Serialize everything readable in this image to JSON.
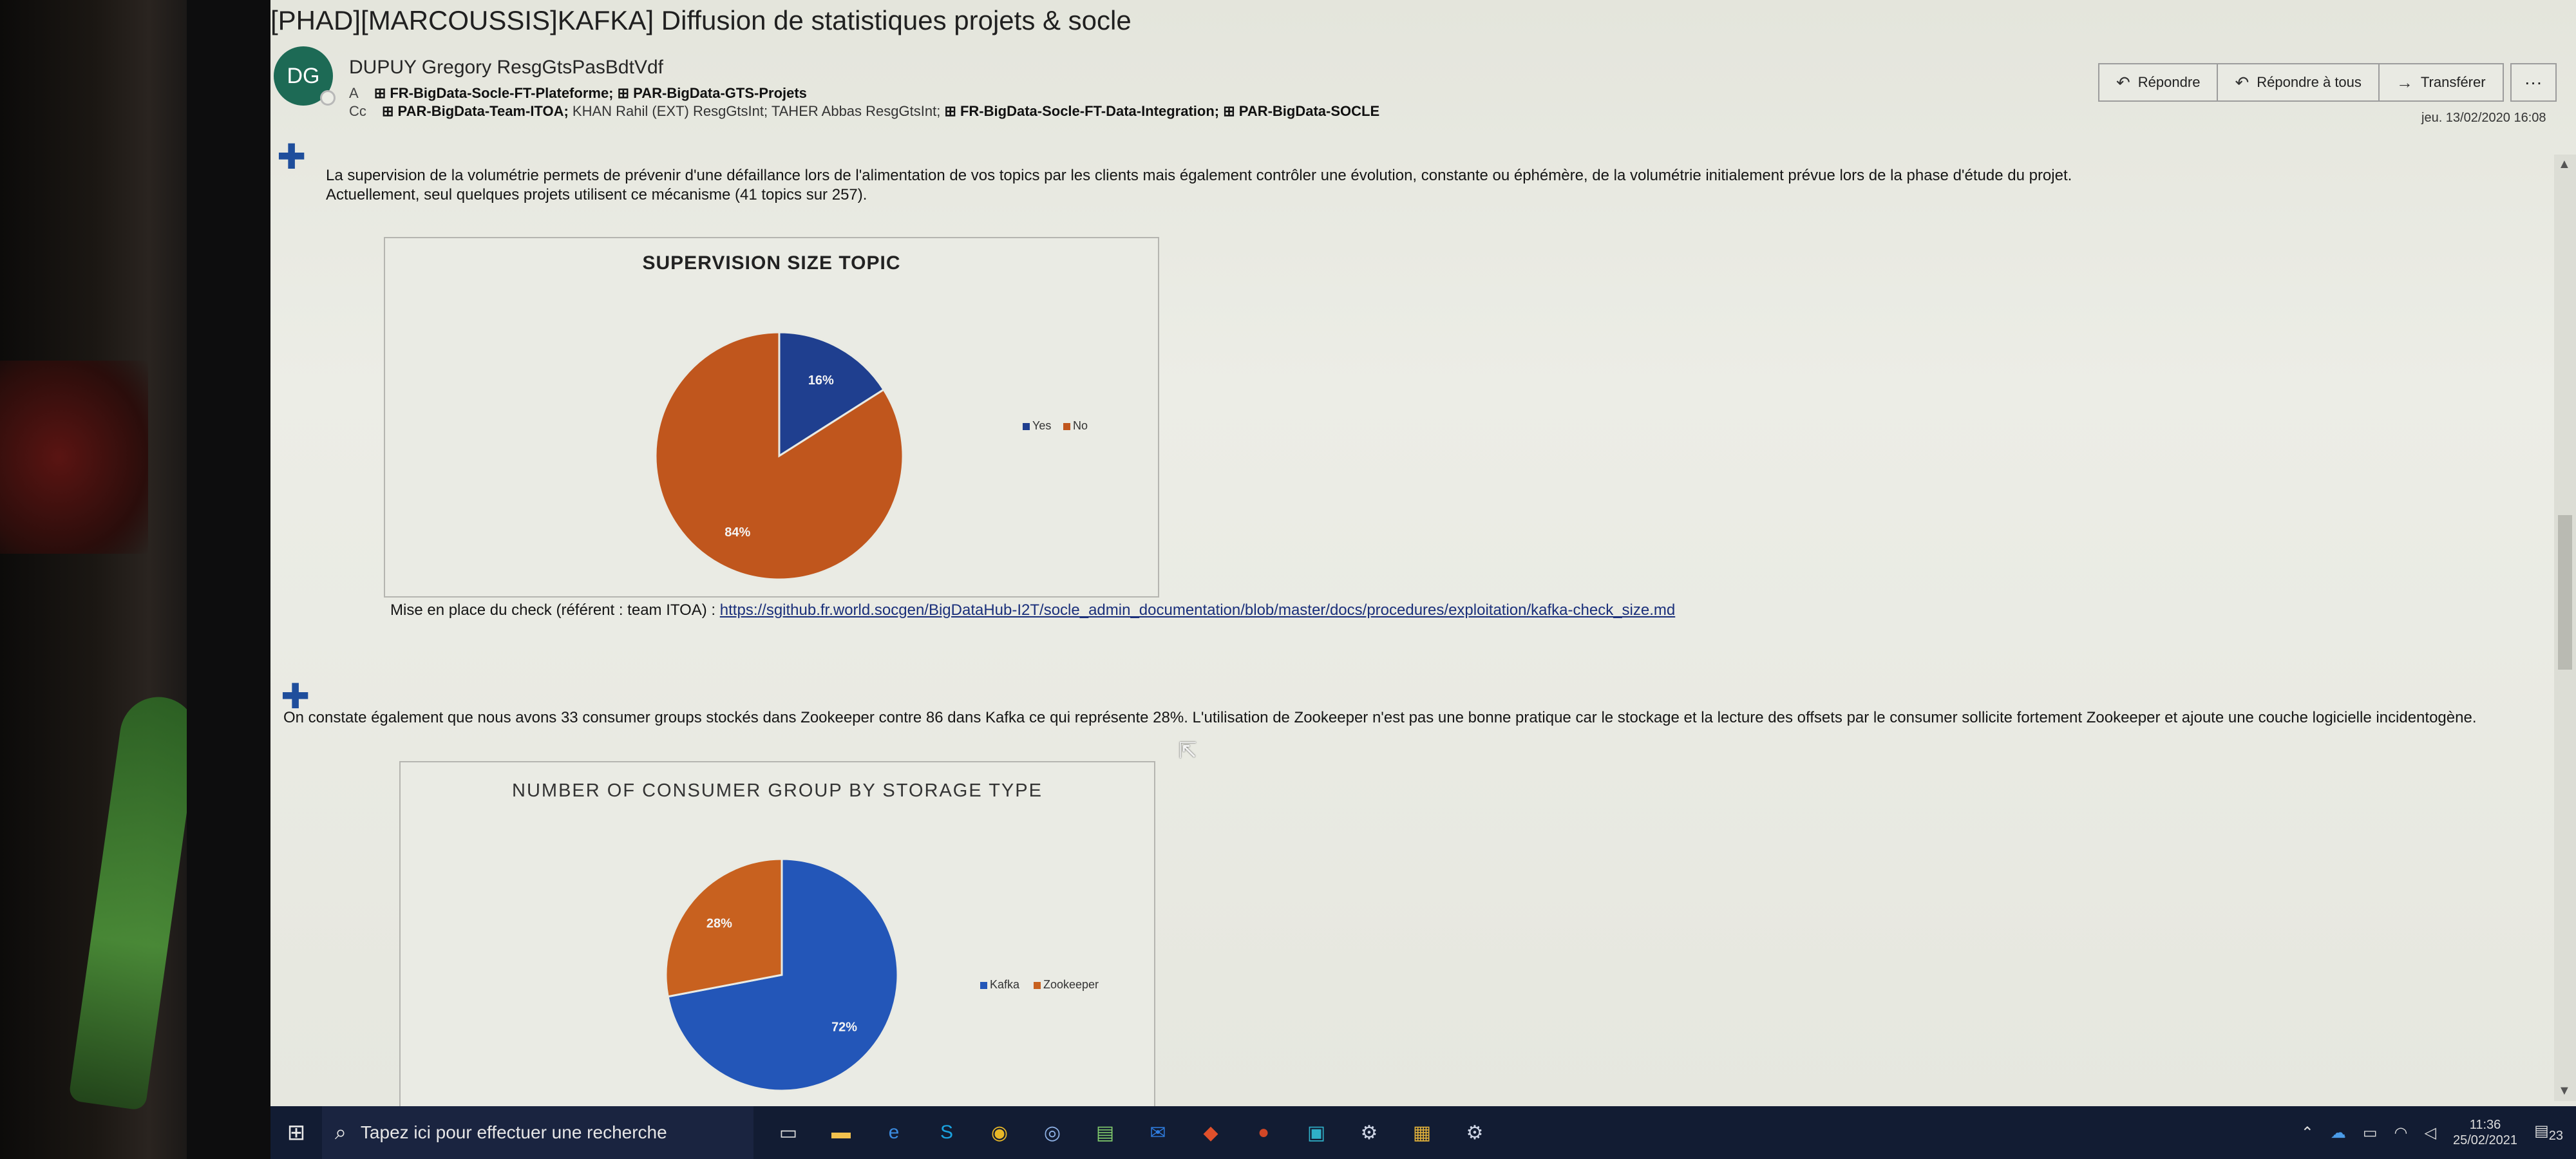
{
  "mail": {
    "title": "[PHAD][MARCOUSSIS]KAFKA] Diffusion de statistiques projets & socle",
    "sender_initials": "DG",
    "sender": "DUPUY Gregory ResgGtsPasBdtVdf",
    "to_label": "A",
    "to": [
      "⊞ FR-BigData-Socle-FT-Plateforme;",
      "⊞ PAR-BigData-GTS-Projets"
    ],
    "cc_label": "Cc",
    "cc": [
      "⊞ PAR-BigData-Team-ITOA;",
      "KHAN Rahil (EXT) ResgGtsInt;",
      "TAHER Abbas ResgGtsInt;",
      "⊞ FR-BigData-Socle-FT-Data-Integration;",
      "⊞ PAR-BigData-SOCLE"
    ],
    "date": "jeu. 13/02/2020 16:08"
  },
  "actions": {
    "reply": "Répondre",
    "reply_all": "Répondre à tous",
    "forward": "Transférer",
    "more": "···"
  },
  "body": {
    "para1_line1": "La supervision de la volumétrie permets de prévenir d'une défaillance lors de l'alimentation de vos topics par les clients mais également contrôler une évolution, constante ou éphémère, de la volumétrie initialement prévue lors de la phase d'étude du projet.",
    "para1_line2": "Actuellement, seul quelques projets utilisent ce mécanisme (41 topics sur 257).",
    "check_label": "Mise en place du check (référent : team ITOA) : ",
    "check_link": "https://sgithub.fr.world.socgen/BigDataHub-I2T/socle_admin_documentation/blob/master/docs/procedures/exploitation/kafka-check_size.md",
    "para2": "On constate également que nous avons 33 consumer groups stockés dans Zookeeper contre 86 dans Kafka ce qui représente 28%. L'utilisation de Zookeeper n'est pas une bonne pratique car le stockage et la lecture des offsets par le consumer sollicite fortement Zookeeper et ajoute une couche logicielle incidentogène."
  },
  "chart_data": [
    {
      "type": "pie",
      "title": "SUPERVISION SIZE TOPIC",
      "categories": [
        "Yes",
        "No"
      ],
      "values": [
        16,
        84
      ],
      "labels": [
        "16%",
        "84%"
      ],
      "colors": [
        "#1f3f8f",
        "#c0561d"
      ],
      "legend": "right"
    },
    {
      "type": "pie",
      "title": "NUMBER OF CONSUMER GROUP BY STORAGE TYPE",
      "categories": [
        "Kafka",
        "Zookeeper"
      ],
      "values": [
        72,
        28
      ],
      "labels": [
        "72%",
        "28%"
      ],
      "colors": [
        "#2356b8",
        "#c8611f"
      ],
      "legend": "right"
    }
  ],
  "taskbar": {
    "search_placeholder": "Tapez ici pour effectuer une recherche",
    "time": "11:36",
    "date": "25/02/2021",
    "notif_count": "23"
  }
}
